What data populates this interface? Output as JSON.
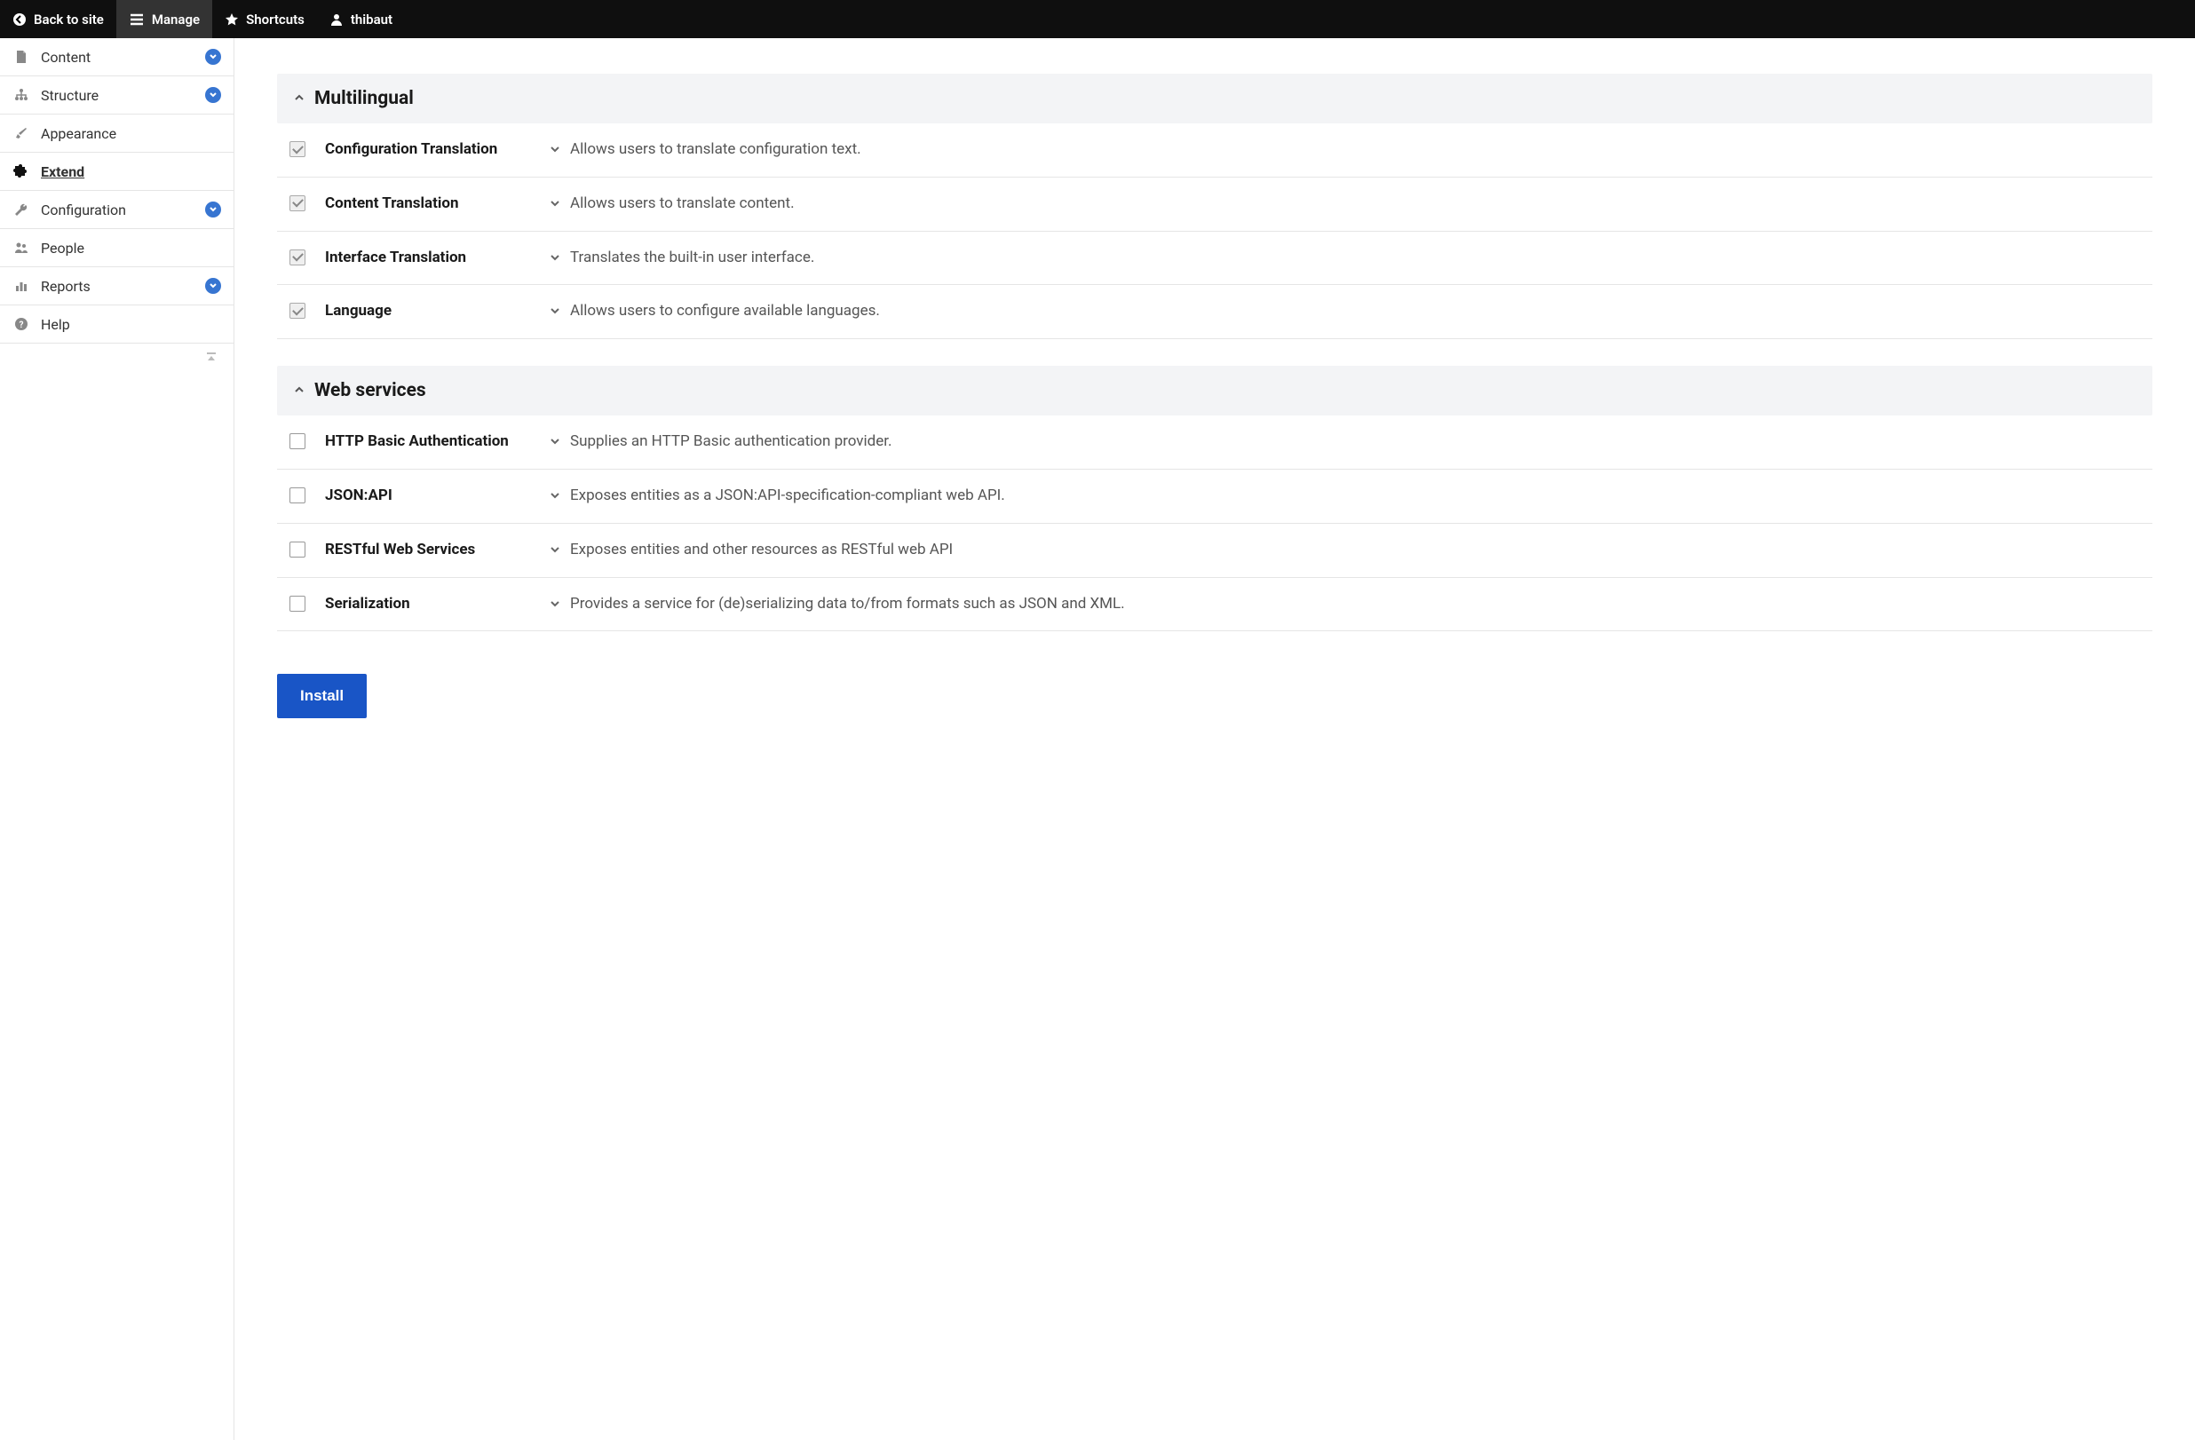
{
  "topbar": {
    "back": "Back to site",
    "manage": "Manage",
    "shortcuts": "Shortcuts",
    "user": "thibaut"
  },
  "sidebar": {
    "items": [
      {
        "label": "Content",
        "has_chevron": true
      },
      {
        "label": "Structure",
        "has_chevron": true
      },
      {
        "label": "Appearance",
        "has_chevron": false
      },
      {
        "label": "Extend",
        "has_chevron": false
      },
      {
        "label": "Configuration",
        "has_chevron": true
      },
      {
        "label": "People",
        "has_chevron": false
      },
      {
        "label": "Reports",
        "has_chevron": true
      },
      {
        "label": "Help",
        "has_chevron": false
      }
    ]
  },
  "sections": [
    {
      "title": "Multilingual",
      "modules": [
        {
          "name": "Configuration Translation",
          "desc": "Allows users to translate configuration text.",
          "checked": true
        },
        {
          "name": "Content Translation",
          "desc": "Allows users to translate content.",
          "checked": true
        },
        {
          "name": "Interface Translation",
          "desc": "Translates the built-in user interface.",
          "checked": true
        },
        {
          "name": "Language",
          "desc": "Allows users to configure available languages.",
          "checked": true
        }
      ]
    },
    {
      "title": "Web services",
      "modules": [
        {
          "name": "HTTP Basic Authentication",
          "desc": "Supplies an HTTP Basic authentication provider.",
          "checked": false
        },
        {
          "name": "JSON:API",
          "desc": "Exposes entities as a JSON:API-specification-compliant web API.",
          "checked": false
        },
        {
          "name": "RESTful Web Services",
          "desc": "Exposes entities and other resources as RESTful web API",
          "checked": false
        },
        {
          "name": "Serialization",
          "desc": "Provides a service for (de)serializing data to/from formats such as JSON and XML.",
          "checked": false
        }
      ]
    }
  ],
  "buttons": {
    "install": "Install"
  }
}
